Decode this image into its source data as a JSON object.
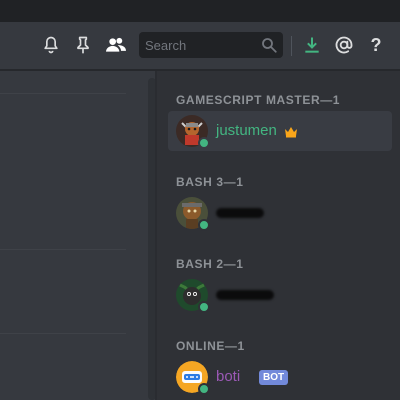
{
  "header": {
    "search": {
      "placeholder": "Search",
      "icon": "magnifier-icon"
    },
    "icons": [
      "bell-icon",
      "pin-icon",
      "members-icon",
      "download-icon",
      "mention-icon",
      "help-icon"
    ],
    "help_glyph": "?",
    "accent_colors": {
      "download": "#43b581",
      "icons": "#dcddde"
    }
  },
  "members": {
    "categories": [
      {
        "title": "GAMESCRIPT MASTER—1",
        "members": [
          {
            "name": "justumen",
            "name_color": "#43b581",
            "owner": true,
            "status": "online"
          }
        ]
      },
      {
        "title": "BASH 3—1",
        "members": [
          {
            "name": "",
            "redacted": true,
            "status": "online"
          }
        ]
      },
      {
        "title": "BASH 2—1",
        "members": [
          {
            "name": "",
            "redacted": true,
            "status": "online"
          }
        ]
      },
      {
        "title": "ONLINE—1",
        "members": [
          {
            "name": "boti",
            "name_color": "#9b59b6",
            "badge": "BOT",
            "status": "online"
          }
        ]
      }
    ]
  },
  "colors": {
    "online": "#43b581",
    "bot_badge": "#7289da",
    "crown": "#faa61a"
  }
}
